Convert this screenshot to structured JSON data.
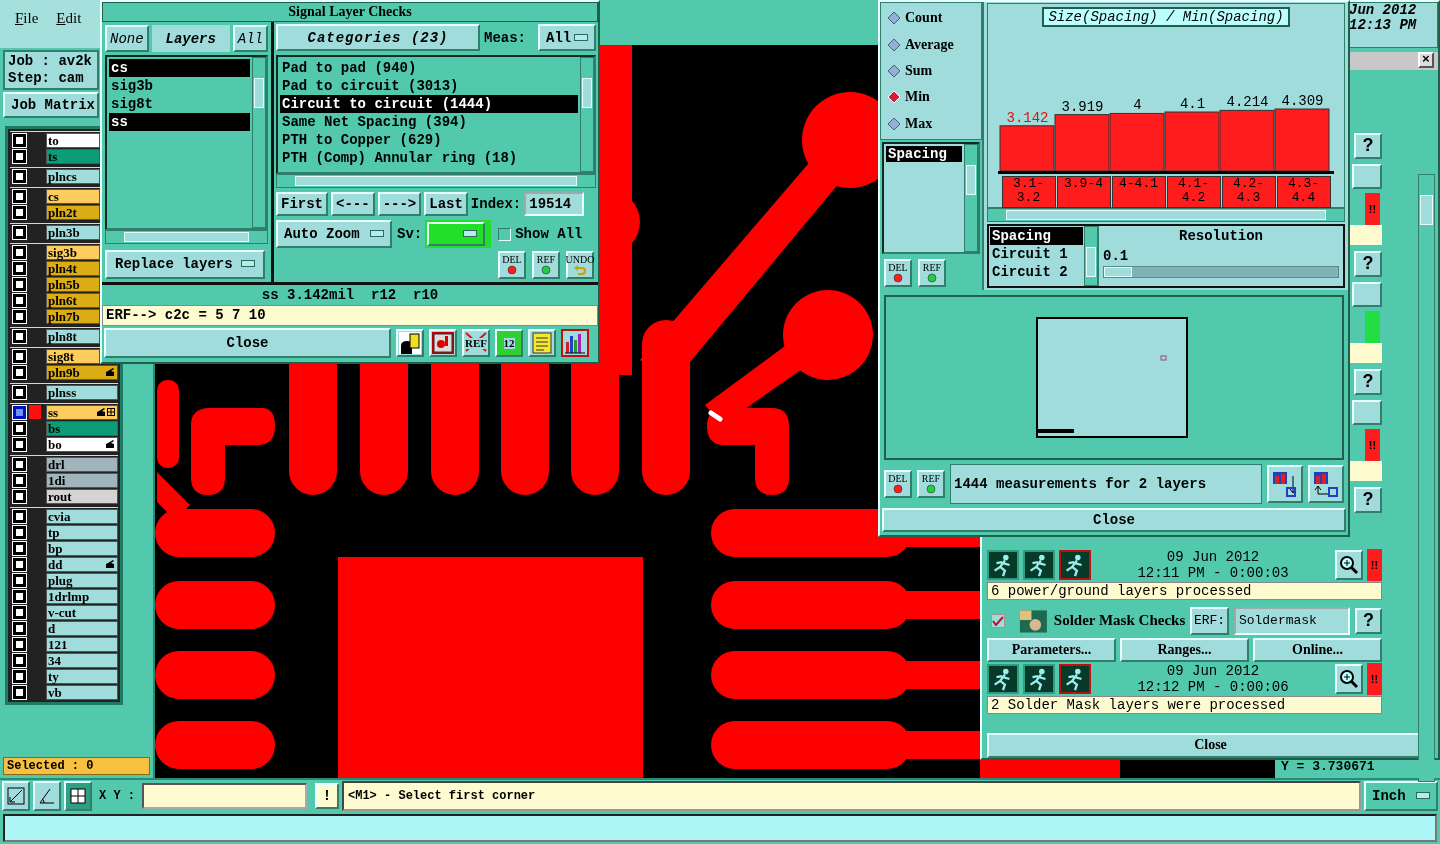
{
  "menu": [
    {
      "label": "File"
    },
    {
      "label": "Edit"
    }
  ],
  "job": {
    "job": "Job : av2k",
    "step": "Step: cam",
    "matrix_button": "Job Matrix"
  },
  "layer_groups": [
    {
      "layers": [
        {
          "name": "to",
          "color": "#ffffff",
          "active": false,
          "shown": false
        },
        {
          "name": "ts",
          "color": "#0c9c78",
          "active": false,
          "shown": false
        }
      ]
    },
    {
      "layers": [
        {
          "name": "plncs",
          "color": "#a0dcdc",
          "active": false,
          "shown": false
        }
      ]
    },
    {
      "layers": [
        {
          "name": "cs",
          "color": "#fccc5c",
          "active": false,
          "shown": false
        },
        {
          "name": "pln2t",
          "color": "#dcac14",
          "active": false,
          "shown": false
        }
      ]
    },
    {
      "layers": [
        {
          "name": "pln3b",
          "color": "#a0dcdc",
          "active": false,
          "shown": false
        }
      ]
    },
    {
      "layers": [
        {
          "name": "sig3b",
          "color": "#fccc5c",
          "active": false,
          "shown": false
        },
        {
          "name": "pln4t",
          "color": "#dcac14",
          "active": false,
          "shown": false
        },
        {
          "name": "pln5b",
          "color": "#dcac14",
          "active": false,
          "shown": false
        },
        {
          "name": "pln6t",
          "color": "#dcac14",
          "active": false,
          "shown": false
        },
        {
          "name": "pln7b",
          "color": "#dcac14",
          "active": false,
          "shown": false
        }
      ]
    },
    {
      "layers": [
        {
          "name": "pln8t",
          "color": "#a0dcdc",
          "active": false,
          "shown": false
        }
      ]
    },
    {
      "layers": [
        {
          "name": "sig8t",
          "color": "#fccc5c",
          "active": false,
          "shown": false
        },
        {
          "name": "pln9b",
          "color": "#dcac14",
          "active": false,
          "shown": false,
          "pointer": true
        }
      ]
    },
    {
      "layers": [
        {
          "name": "plnss",
          "color": "#a0dcdc",
          "active": false,
          "shown": false
        }
      ]
    },
    {
      "layers": [
        {
          "name": "ss",
          "color": "#fccc5c",
          "active": true,
          "shown": true,
          "pointer": true,
          "grid": true
        },
        {
          "name": "bs",
          "color": "#0c9c78",
          "active": false,
          "shown": false
        },
        {
          "name": "bo",
          "color": "#ffffff",
          "active": false,
          "shown": false,
          "pointer": true
        }
      ]
    },
    {
      "layers": [
        {
          "name": "drl",
          "color": "#a0b4bc",
          "active": false,
          "shown": false
        },
        {
          "name": "1di",
          "color": "#a0b4bc",
          "active": false,
          "shown": false
        },
        {
          "name": "rout",
          "color": "#d4d4d4",
          "active": false,
          "shown": false
        }
      ]
    },
    {
      "layers": [
        {
          "name": "cvia",
          "color": "#a0dcdc",
          "active": false,
          "shown": false
        },
        {
          "name": "tp",
          "color": "#a0dcdc",
          "active": false,
          "shown": false
        },
        {
          "name": "bp",
          "color": "#a0dcdc",
          "active": false,
          "shown": false
        },
        {
          "name": "dd",
          "color": "#a0dcdc",
          "active": false,
          "shown": false,
          "pointer": true
        },
        {
          "name": "plug",
          "color": "#a0dcdc",
          "active": false,
          "shown": false
        },
        {
          "name": "1drlmp",
          "color": "#a0dcdc",
          "active": false,
          "shown": false
        },
        {
          "name": "v-cut",
          "color": "#a0dcdc",
          "active": false,
          "shown": false
        },
        {
          "name": "d",
          "color": "#a0dcdc",
          "active": false,
          "shown": false
        },
        {
          "name": "121",
          "color": "#a0dcdc",
          "active": false,
          "shown": false
        },
        {
          "name": "34",
          "color": "#a0dcdc",
          "active": false,
          "shown": false
        },
        {
          "name": "ty",
          "color": "#a0dcdc",
          "active": false,
          "shown": false
        },
        {
          "name": "vb",
          "color": "#a0dcdc",
          "active": false,
          "shown": false
        }
      ]
    }
  ],
  "selection": "Selected : 0",
  "signal_checks": {
    "title": "Signal Layer Checks",
    "layer_buttons": [
      {
        "label": "None",
        "kind": "button"
      },
      {
        "label": "Layers",
        "kind": "label"
      },
      {
        "label": "All",
        "kind": "button"
      }
    ],
    "layers": [
      {
        "name": "cs",
        "selected": true
      },
      {
        "name": "sig3b",
        "selected": false
      },
      {
        "name": "sig8t",
        "selected": false
      },
      {
        "name": "ss",
        "selected": true
      }
    ],
    "replace": "Replace layers",
    "categories_button": "Categories (23)",
    "meas_label": "Meas:",
    "meas_value": "All",
    "categories": [
      {
        "label": "Pad to pad (940)",
        "selected": false
      },
      {
        "label": "Pad to circuit (3013)",
        "selected": false
      },
      {
        "label": "Circuit to circuit (1444)",
        "selected": true
      },
      {
        "label": "Same Net Spacing (394)",
        "selected": false
      },
      {
        "label": "PTH to Copper (629)",
        "selected": false
      },
      {
        "label": "PTH (Comp) Annular ring (18)",
        "selected": false
      }
    ],
    "nav": [
      "First",
      "<---",
      "--->",
      "Last"
    ],
    "index_label": "Index:",
    "index_value": "19514",
    "zoom_mode": "Auto Zoom",
    "sv_label": "Sv:",
    "show_all": {
      "label": "Show All",
      "checked": false
    },
    "edit_buttons": [
      {
        "label": "DEL",
        "kind": "del"
      },
      {
        "label": "REF",
        "kind": "ref"
      },
      {
        "label": "UNDO",
        "kind": "undo"
      }
    ],
    "status": "ss 3.142mil  r12  r10",
    "erf": "ERF--> c2c = 5 7 10",
    "close": "Close",
    "tools": [
      {
        "kind": "report",
        "selected": false
      },
      {
        "kind": "marker",
        "selected": false
      },
      {
        "kind": "erase",
        "label": "REF",
        "selected": false
      },
      {
        "kind": "counter",
        "label": "12",
        "selected": false
      },
      {
        "kind": "notes",
        "selected": false
      },
      {
        "kind": "chart",
        "selected": true
      }
    ]
  },
  "histogram": {
    "modes": [
      {
        "label": "Count",
        "selected": false
      },
      {
        "label": "Average",
        "selected": false
      },
      {
        "label": "Sum",
        "selected": false
      },
      {
        "label": "Min",
        "selected": true
      },
      {
        "label": "Max",
        "selected": false
      }
    ],
    "measures": [
      {
        "label": "Spacing",
        "selected": true
      }
    ],
    "edit_buttons": [
      {
        "label": "DEL",
        "kind": "del"
      },
      {
        "label": "REF",
        "kind": "ref"
      }
    ],
    "chart_data": {
      "type": "bar",
      "title": "Size(Spacing) / Min(Spacing)",
      "categories": [
        "3.1-3.2",
        "3.9-4",
        "4-4.1",
        "4.1-4.2",
        "4.2-4.3",
        "4.3-4.4"
      ],
      "series": [
        {
          "color": "#ff1c1c",
          "values": [
            3.142,
            3.919,
            4,
            4.1,
            4.214,
            4.309
          ]
        }
      ],
      "data_labels": true
    },
    "fields": [
      {
        "label": "Spacing",
        "selected": true
      },
      {
        "label": "Circuit 1",
        "selected": false
      },
      {
        "label": "Circuit 2",
        "selected": false
      }
    ],
    "resolution": {
      "label": "Resolution",
      "value": "0.1",
      "level": 0.12
    },
    "bottom_buttons": [
      {
        "label": "DEL",
        "kind": "del"
      },
      {
        "label": "REF",
        "kind": "ref"
      }
    ],
    "message": "1444 measurements for 2 layers",
    "close": "Close"
  },
  "right_panel": {
    "date": "Jun 2012",
    "time": "12:13 PM",
    "close_label": "×",
    "side_items": [
      {
        "kind": "help",
        "label": "?"
      },
      {
        "kind": "tool"
      },
      {
        "kind": "flag",
        "label": "!!",
        "color": "#ff1c1c"
      },
      {
        "kind": "note"
      },
      {
        "kind": "help",
        "label": "?"
      },
      {
        "kind": "tool"
      },
      {
        "kind": "flag",
        "color": "#22dd44"
      },
      {
        "kind": "note"
      },
      {
        "kind": "help",
        "label": "?"
      },
      {
        "kind": "tool"
      },
      {
        "kind": "flag",
        "label": "!!",
        "color": "#ff1c1c"
      },
      {
        "kind": "note"
      },
      {
        "kind": "help",
        "label": "?"
      }
    ],
    "checks": [
      {
        "date": "09 Jun 2012",
        "time": "12:11 PM - 0:00:03",
        "flag": {
          "label": "!!",
          "color": "#ff1c1c"
        },
        "result": "6 power/ground layers processed"
      },
      {
        "name": "Solder Mask Checks",
        "checked": true,
        "erf_label": "ERF:",
        "erf_value": "Soldermask",
        "help": "?",
        "buttons": [
          "Parameters...",
          "Ranges...",
          "Online..."
        ],
        "date": "09 Jun 2012",
        "time": "12:12 PM - 0:00:06",
        "flag": {
          "label": "!!",
          "color": "#ff1c1c"
        },
        "result": "2 Solder Mask layers were processed"
      }
    ],
    "close": "Close"
  },
  "coordinate": "Y = 3.730671",
  "bottom_bar": {
    "tools": [
      {
        "kind": "fit",
        "selected": false
      },
      {
        "kind": "measure",
        "selected": false
      },
      {
        "kind": "grid",
        "selected": true
      }
    ],
    "coords_label": "X Y :",
    "alert": "!",
    "message": "<M1> - Select first corner",
    "units": "Inch"
  }
}
